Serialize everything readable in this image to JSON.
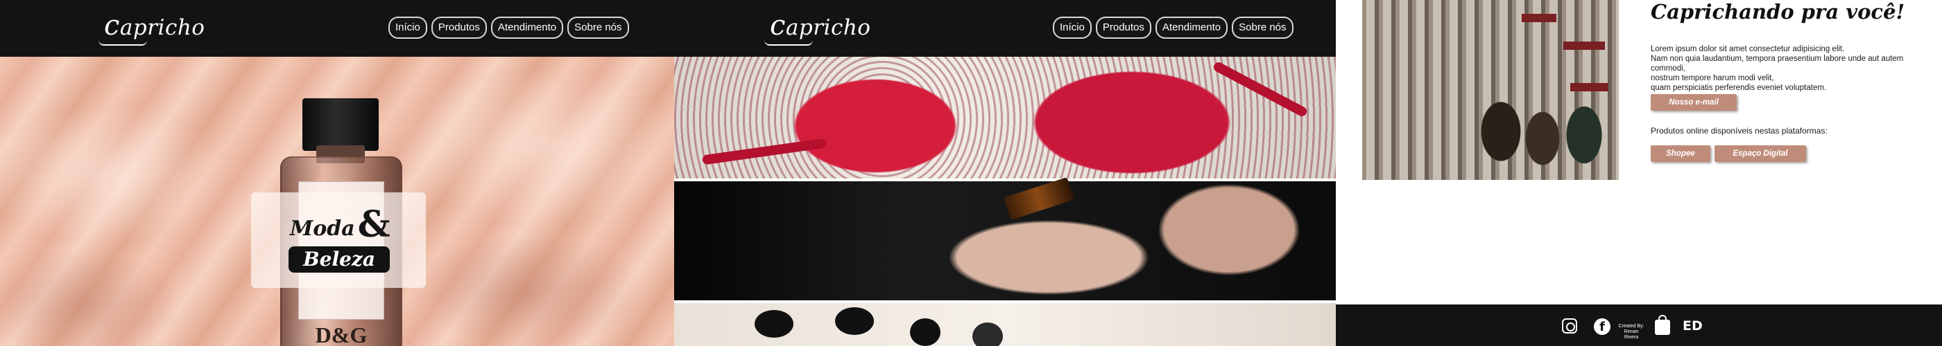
{
  "brand": {
    "logo": "apricho"
  },
  "nav": [
    "Início",
    "Produtos",
    "Atendimento",
    "Sobre nós"
  ],
  "hero": {
    "badge_word_1": "Moda",
    "badge_ampersand": "&",
    "badge_word_2": "Beleza",
    "bottle_brand": "D&G"
  },
  "about": {
    "title": "Caprichando pra você!",
    "paragraph_lines": [
      "Lorem ipsum dolor sit amet consectetur adipisicing elit.",
      "Nam non quia laudantium, tempora praesentium labore unde aut autem commodi,",
      "nostrum tempore harum modi velit,",
      "quam perspiciatis perferendis eveniet voluptatem."
    ],
    "email_button": "Nosso e-mail",
    "online_text": "Produtos online disponíveis nestas plataformas:",
    "platform_buttons": [
      "Shopee",
      "Espaço Digital"
    ]
  },
  "footer": {
    "created_by_line_1": "Created By:",
    "created_by_line_2": "Renan Rivera",
    "icons": [
      "instagram-icon",
      "facebook-icon",
      "shopping-bag-icon",
      "ed-logo-icon"
    ]
  },
  "colors": {
    "header_bg": "#131313",
    "accent_button": "#c08c7a",
    "hero_fabric": "#f1c6b3"
  }
}
